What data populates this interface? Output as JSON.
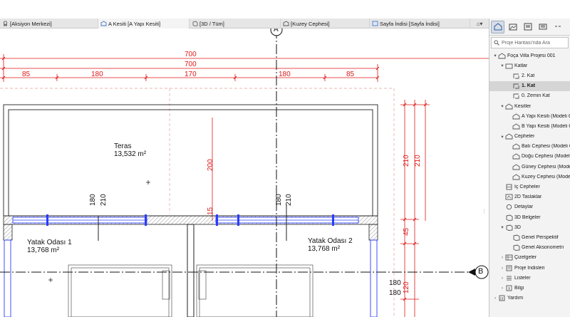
{
  "tabs": [
    {
      "label": "[Aksiyon Merkezi]",
      "icon": "action-center-icon"
    },
    {
      "label": "A Kesiti [A Yapı Kesiti]",
      "icon": "section-icon"
    },
    {
      "label": "[3D / Tüm]",
      "icon": "3d-icon"
    },
    {
      "label": "[Kuzey Cephesi]",
      "icon": "elevation-icon"
    },
    {
      "label": "Sayfa İndisi [Sayfa İndisi]",
      "icon": "layout-icon"
    }
  ],
  "tab_overflow_label": "⌂▾",
  "drawing": {
    "dim_top_total_1": "700",
    "dim_top_total_2": "700",
    "dim_segments": [
      "85",
      "180",
      "170",
      "180",
      "85"
    ],
    "vertical_dims_right": [
      "210",
      "210",
      "45",
      "180",
      "180",
      "120"
    ],
    "vertical_dim_center": "200",
    "vertical_dim_center_low": "15",
    "window_labels_left": [
      "180",
      "210"
    ],
    "window_labels_mid": [
      "180",
      "210"
    ],
    "grid_top_label": "A",
    "grid_right_label": "B",
    "rooms": [
      {
        "name": "Teras",
        "area": "13,532 m²"
      },
      {
        "name": "Yatak Odası 1",
        "area": "13,768 m²"
      },
      {
        "name": "Yatak Odası 2",
        "area": "13,768 m²"
      }
    ],
    "colors": {
      "dimension": "#e01818",
      "wall": "#222222",
      "window": "#2a3cff",
      "guides": "#e59a9a"
    }
  },
  "navigator": {
    "search_placeholder": "Proje Haritası'nda Ara",
    "toolbar_icons": [
      "project-map-icon",
      "view-map-icon",
      "layout-book-icon",
      "publisher-icon",
      "more-icon"
    ],
    "tree": [
      {
        "label": "Foça Villa Projesi 001",
        "level": 0,
        "arrow": "▾",
        "icon": "project-icon"
      },
      {
        "label": "Katlar",
        "level": 1,
        "arrow": "▾",
        "icon": "stories-icon"
      },
      {
        "label": "2. Kat",
        "level": 2,
        "arrow": "",
        "icon": "story-icon"
      },
      {
        "label": "1. Kat",
        "level": 2,
        "arrow": "",
        "icon": "story-icon",
        "selected": true
      },
      {
        "label": "0. Zemin Kat",
        "level": 2,
        "arrow": "",
        "icon": "story-icon"
      },
      {
        "label": "Kesitler",
        "level": 1,
        "arrow": "▾",
        "icon": "sections-icon"
      },
      {
        "label": "A Yapı Kesiti (Modeli O",
        "level": 2,
        "arrow": "",
        "icon": "section-icon"
      },
      {
        "label": "B Yapı Kesiti (Modeli O",
        "level": 2,
        "arrow": "",
        "icon": "section-icon"
      },
      {
        "label": "Cepheler",
        "level": 1,
        "arrow": "▾",
        "icon": "elevations-icon"
      },
      {
        "label": "Batı Cephesi (Modeli O",
        "level": 2,
        "arrow": "",
        "icon": "elevation-icon"
      },
      {
        "label": "Doğu Cephesi (Modeli",
        "level": 2,
        "arrow": "",
        "icon": "elevation-icon"
      },
      {
        "label": "Güney Cephesi (Modeli",
        "level": 2,
        "arrow": "",
        "icon": "elevation-icon"
      },
      {
        "label": "Kuzey Cephesi (Modeli",
        "level": 2,
        "arrow": "",
        "icon": "elevation-icon"
      },
      {
        "label": "İç Cepheler",
        "level": 1,
        "arrow": "",
        "icon": "interior-elevations-icon"
      },
      {
        "label": "2D Taslaklar",
        "level": 1,
        "arrow": "",
        "icon": "worksheets-icon"
      },
      {
        "label": "Detaylar",
        "level": 1,
        "arrow": "",
        "icon": "details-icon"
      },
      {
        "label": "3D Belgeler",
        "level": 1,
        "arrow": "",
        "icon": "3d-documents-icon"
      },
      {
        "label": "3D",
        "level": 1,
        "arrow": "▾",
        "icon": "3d-folder-icon"
      },
      {
        "label": "Genel Perspektif",
        "level": 2,
        "arrow": "",
        "icon": "perspective-icon"
      },
      {
        "label": "Genel Aksonometri",
        "level": 2,
        "arrow": "",
        "icon": "axonometry-icon"
      },
      {
        "label": "Çizelgeler",
        "level": 1,
        "arrow": "›",
        "icon": "schedules-icon"
      },
      {
        "label": "Proje İndisleri",
        "level": 1,
        "arrow": "›",
        "icon": "project-indexes-icon"
      },
      {
        "label": "Listeler",
        "level": 1,
        "arrow": "›",
        "icon": "lists-icon"
      },
      {
        "label": "Bilgi",
        "level": 1,
        "arrow": "›",
        "icon": "info-icon"
      },
      {
        "label": "Yardım",
        "level": 0,
        "arrow": "›",
        "icon": "help-icon"
      }
    ]
  }
}
